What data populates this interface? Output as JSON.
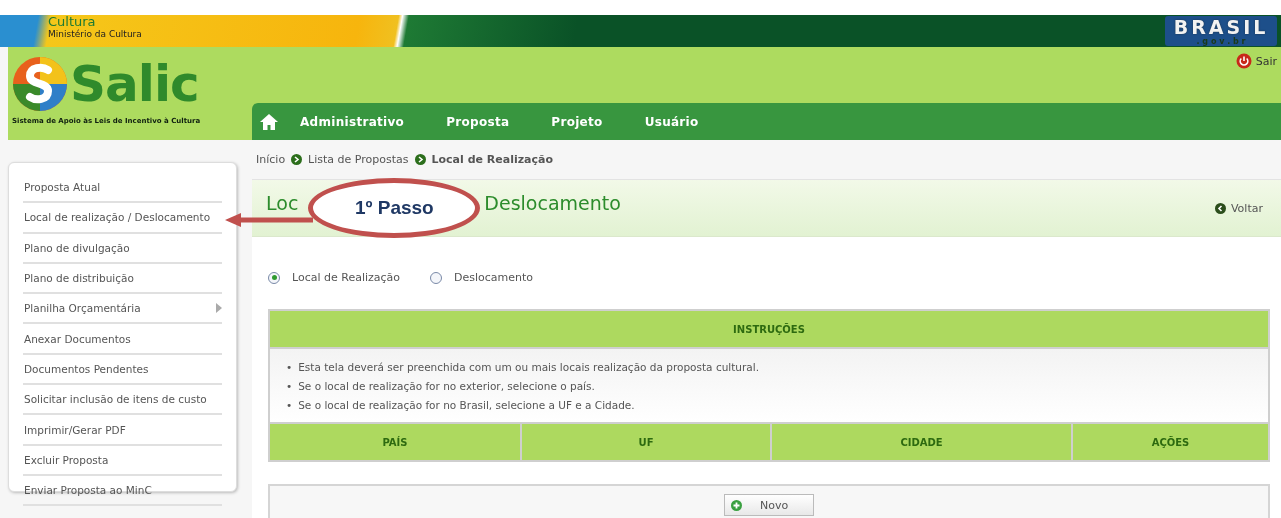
{
  "banner": {
    "title": "Cultura",
    "subtitle": "Ministério da Cultura",
    "badge_title": "BRASIL",
    "badge_subtitle": ". g o v . b r"
  },
  "header": {
    "logo_text": "Salic",
    "tagline": "Sistema de Apoio às Leis de Incentivo à Cultura",
    "logout": "Sair"
  },
  "nav": {
    "items": [
      "Administrativo",
      "Proposta",
      "Projeto",
      "Usuário"
    ]
  },
  "breadcrumb": [
    {
      "label": "Início",
      "current": false
    },
    {
      "label": "Lista de Propostas",
      "current": false
    },
    {
      "label": "Local de Realização",
      "current": true
    }
  ],
  "sidebar": {
    "items": [
      {
        "label": "Proposta Atual",
        "submenu": false
      },
      {
        "label": "Local de realização / Deslocamento",
        "submenu": false
      },
      {
        "label": "Plano de divulgação",
        "submenu": false
      },
      {
        "label": "Plano de distribuição",
        "submenu": false
      },
      {
        "label": "Planilha Orçamentária",
        "submenu": true
      },
      {
        "label": "Anexar Documentos",
        "submenu": false
      },
      {
        "label": "Documentos Pendentes",
        "submenu": false
      },
      {
        "label": "Solicitar inclusão de itens de custo",
        "submenu": false
      },
      {
        "label": "Imprimir/Gerar PDF",
        "submenu": false
      },
      {
        "label": "Excluir Proposta",
        "submenu": false
      },
      {
        "label": "Enviar Proposta ao MinC",
        "submenu": false
      }
    ]
  },
  "page": {
    "title_start": "Loc",
    "title_end": "Deslocamento",
    "back": "Voltar"
  },
  "callout": {
    "text": "1º Passo"
  },
  "options": [
    {
      "label": "Local de Realização",
      "selected": true
    },
    {
      "label": "Deslocamento",
      "selected": false
    }
  ],
  "instructions": {
    "heading": "INSTRUÇÕES",
    "bullet": "•",
    "items": [
      "Esta tela deverá ser preenchida com um ou mais locais realização da proposta cultural.",
      "Se o local de realização for no exterior, selecione o país.",
      "Se o local de realização for no Brasil, selecione a UF e a Cidade."
    ]
  },
  "table": {
    "columns": [
      "PAÍS",
      "UF",
      "CIDADE",
      "AÇÕES"
    ]
  },
  "new_button": "Novo"
}
